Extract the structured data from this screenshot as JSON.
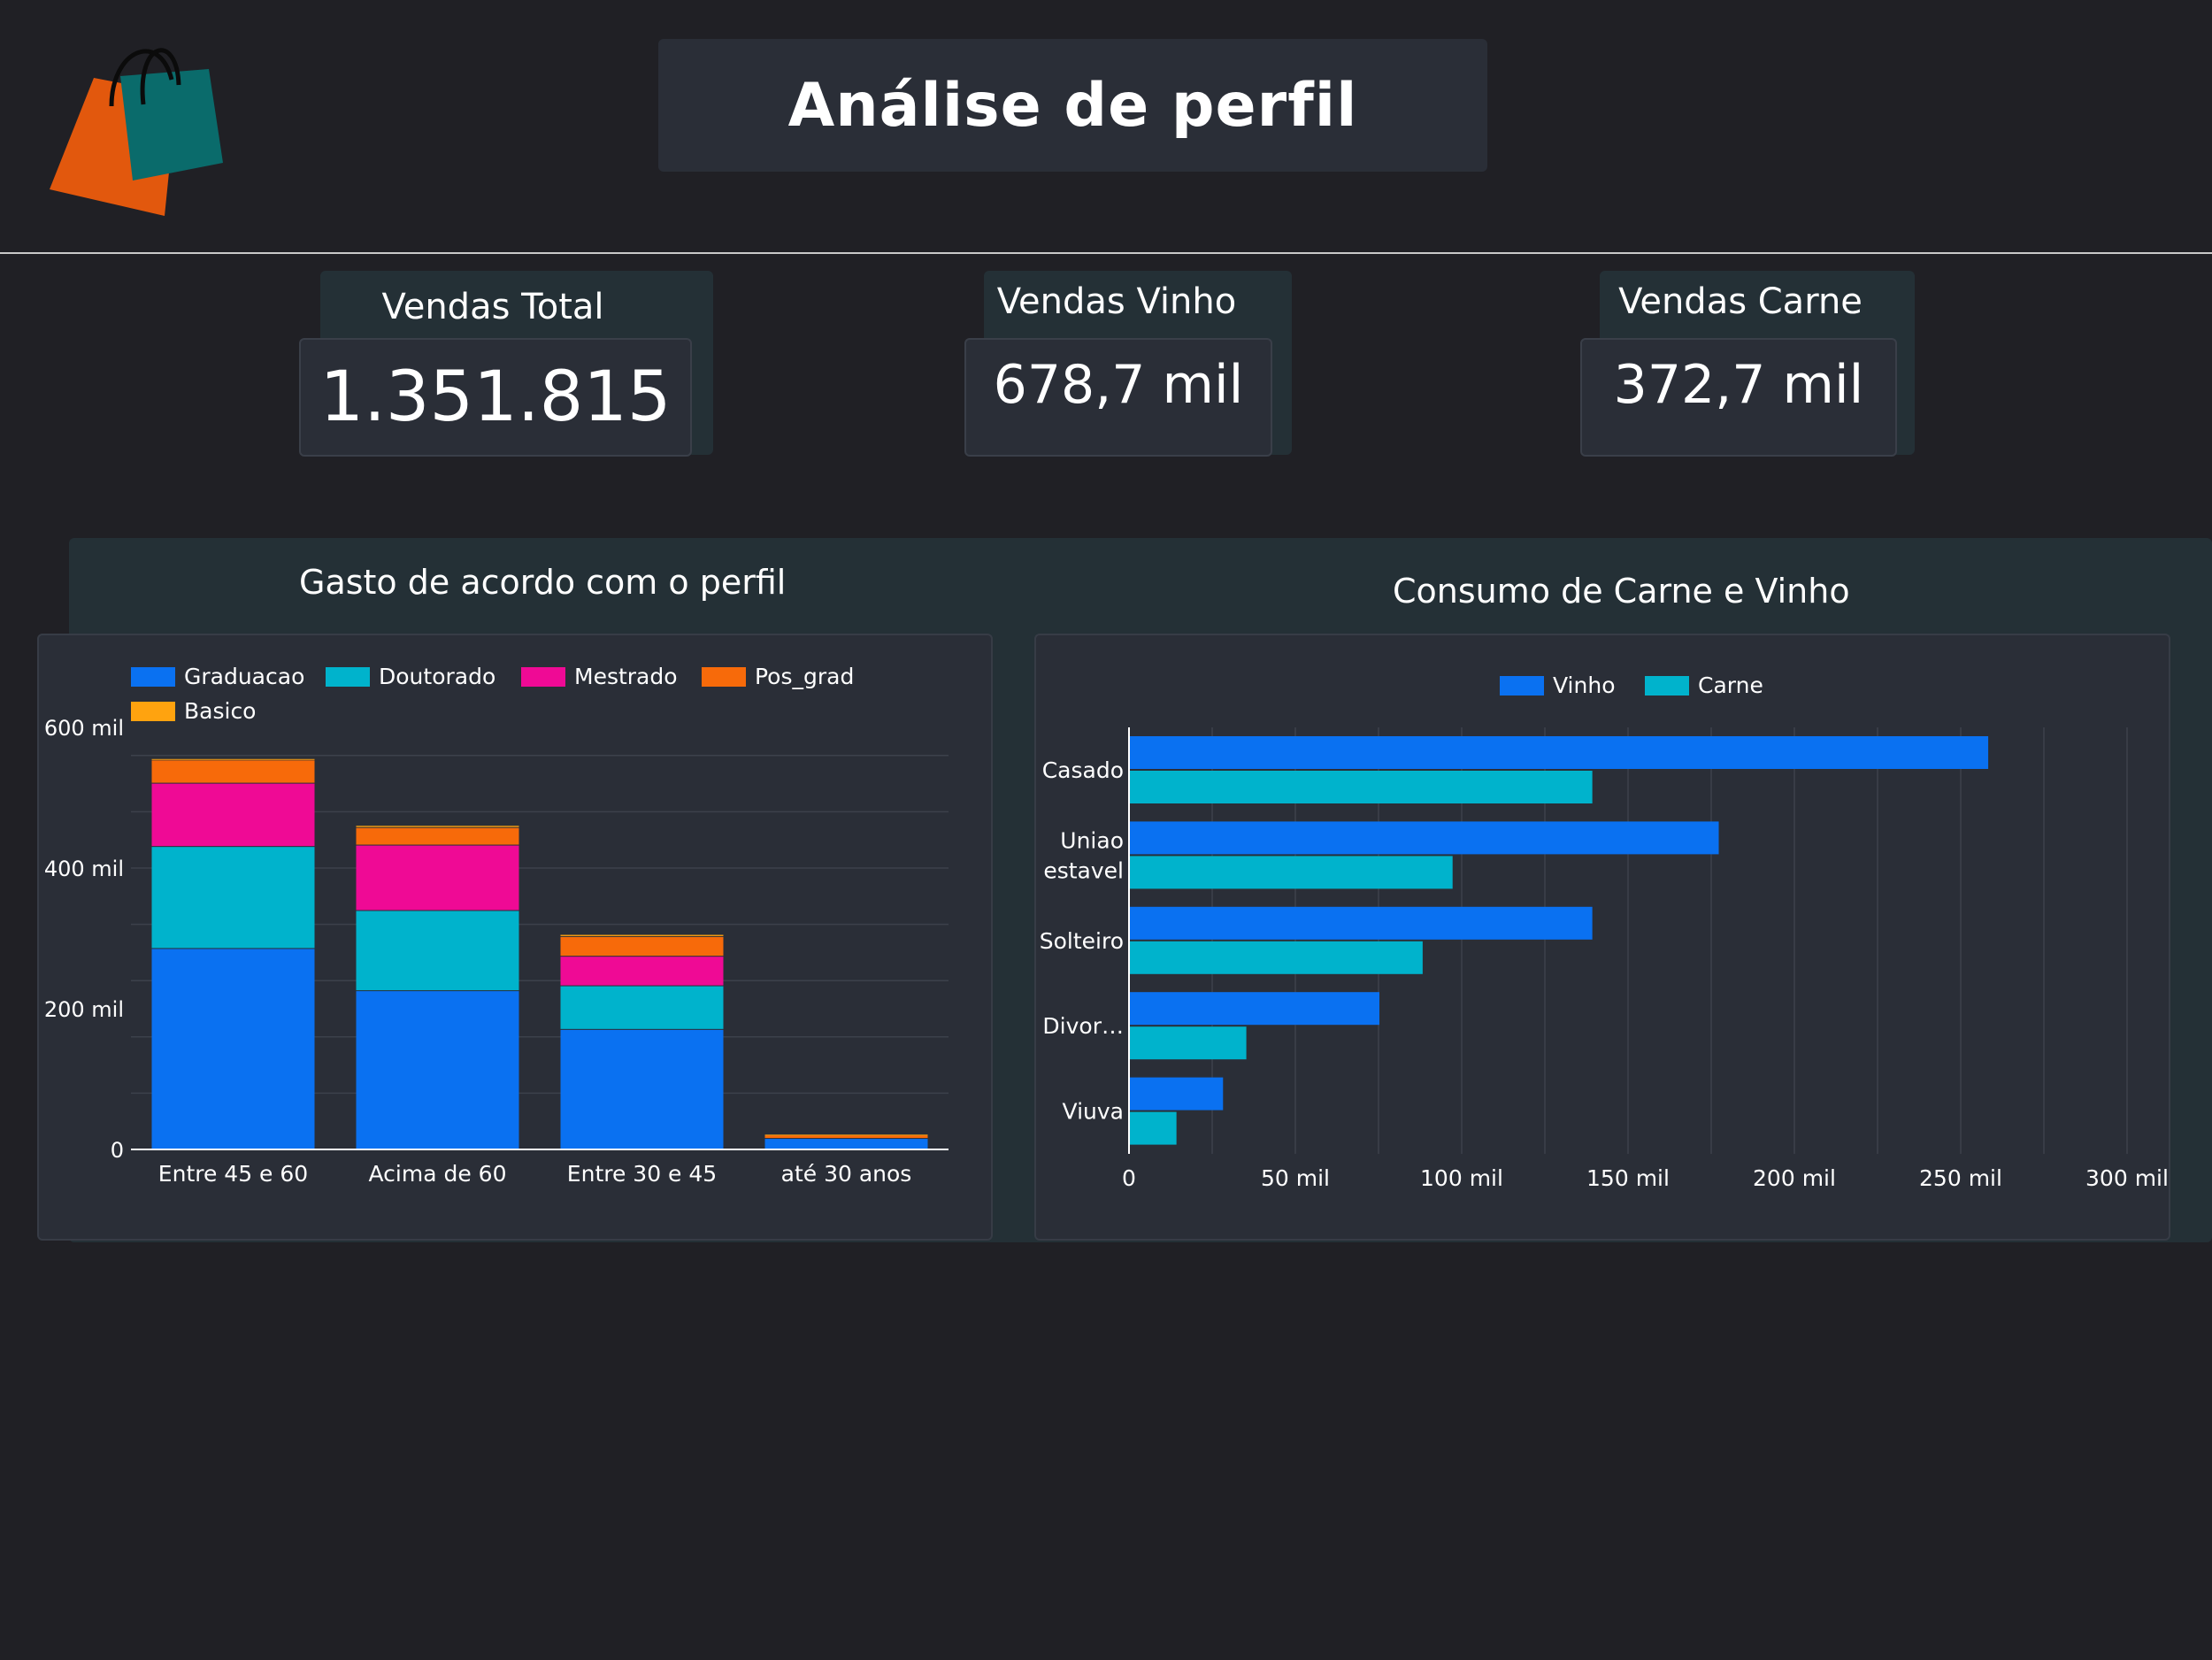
{
  "header": {
    "title": "Análise de perfil",
    "logo": "shopping-bags-logo"
  },
  "kpis": {
    "total": {
      "label": "Vendas Total",
      "value": "1.351.815"
    },
    "vinho": {
      "label": "Vendas Vinho",
      "value": "678,7 mil"
    },
    "carne": {
      "label": "Vendas Carne",
      "value": "372,7 mil"
    }
  },
  "colors": {
    "background": "#202025",
    "card": "#2a2e37",
    "panel": "#243036",
    "blue": "#0a71f1",
    "teal": "#00b3cc",
    "magenta": "#ef0a95",
    "orange": "#f76a0a",
    "yellow": "#ffa30f",
    "bag_orange": "#e2580d",
    "bag_teal": "#0a6b6b"
  },
  "chart_data": [
    {
      "type": "bar",
      "stacked": true,
      "title": "Gasto de acordo com o perfil",
      "categories": [
        "Entre 45 e 60",
        "Acima de 60",
        "Entre 30 e 45",
        "até 30 anos"
      ],
      "series": [
        {
          "name": "Graduacao",
          "color": "#0a71f1",
          "values": [
            285000,
            225000,
            170000,
            15000
          ]
        },
        {
          "name": "Doutorado",
          "color": "#00b3cc",
          "values": [
            145000,
            114000,
            62000,
            0
          ]
        },
        {
          "name": "Mestrado",
          "color": "#ef0a95",
          "values": [
            90000,
            93000,
            42000,
            0
          ]
        },
        {
          "name": "Pos_grad",
          "color": "#f76a0a",
          "values": [
            33000,
            25000,
            28000,
            5000
          ]
        },
        {
          "name": "Basico",
          "color": "#ffa30f",
          "values": [
            2000,
            3000,
            3000,
            1000
          ]
        }
      ],
      "ylim": [
        0,
        600000
      ],
      "yticks": [
        0,
        200000,
        400000,
        600000
      ],
      "ytick_labels": [
        "0",
        "200 mil",
        "400 mil",
        "600 mil"
      ],
      "grid": true,
      "legend": "top-left"
    },
    {
      "type": "bar",
      "orientation": "horizontal",
      "title": "Consumo de Carne e Vinho",
      "categories": [
        [
          "Casado"
        ],
        [
          "Uniao",
          "estavel"
        ],
        [
          "Solteiro"
        ],
        [
          "Divor…"
        ],
        [
          "Viuva"
        ]
      ],
      "series": [
        {
          "name": "Vinho",
          "color": "#0a71f1",
          "values": [
            258000,
            177000,
            139000,
            75000,
            28000
          ]
        },
        {
          "name": "Carne",
          "color": "#00b3cc",
          "values": [
            139000,
            97000,
            88000,
            35000,
            14000
          ]
        }
      ],
      "xlim": [
        0,
        300000
      ],
      "xticks": [
        0,
        50000,
        100000,
        150000,
        200000,
        250000,
        300000
      ],
      "xtick_labels": [
        "0",
        "50 mil",
        "100 mil",
        "150 mil",
        "200 mil",
        "250 mil",
        "300 mil"
      ],
      "grid": true,
      "legend": "top-center"
    }
  ]
}
